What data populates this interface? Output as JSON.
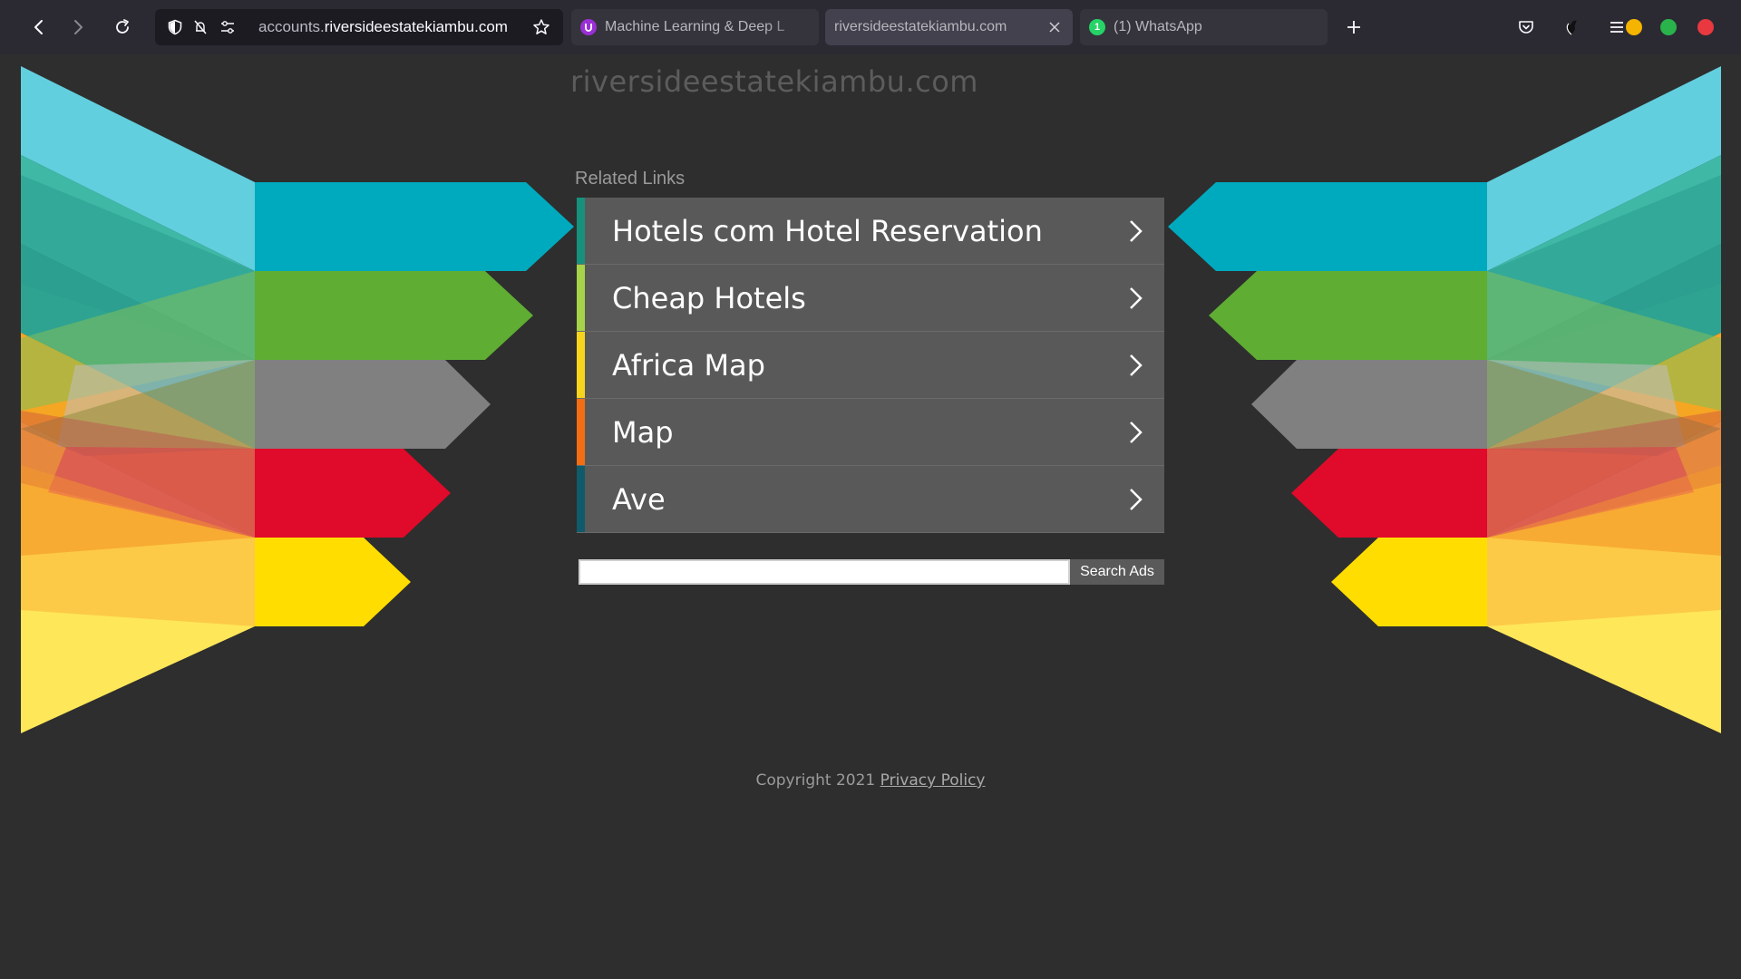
{
  "browser": {
    "url_prefix": "accounts.",
    "url_domain": "riversideestatekiambu.com",
    "tabs": [
      {
        "title": "Machine Learning & Deep L",
        "favicon": "ublock-icon",
        "favicon_color": "#9b2fd6",
        "active": false
      },
      {
        "title": "riversideestatekiambu.com",
        "favicon": "",
        "active": true
      },
      {
        "title": "(1) WhatsApp",
        "favicon": "whatsapp-icon",
        "favicon_color": "#25d366",
        "favicon_badge": "1",
        "active": false
      }
    ],
    "window_controls_colors": {
      "minimize": "#f4b400",
      "maximize": "#2ab24b",
      "close": "#e9383f"
    }
  },
  "page": {
    "site_title": "riversideestatekiambu.com",
    "related_heading": "Related Links",
    "links": [
      {
        "label": "Hotels com Hotel Reservation",
        "accent": "#16917e"
      },
      {
        "label": "Cheap Hotels",
        "accent": "#a6d34a"
      },
      {
        "label": "Africa Map",
        "accent": "#f7d51d"
      },
      {
        "label": "Map",
        "accent": "#f26d14"
      },
      {
        "label": "Ave",
        "accent": "#0f5a6b"
      }
    ],
    "search": {
      "value": "",
      "button_label": "Search Ads"
    },
    "footer": {
      "copyright": "Copyright 2021 ",
      "privacy_label": "Privacy Policy"
    }
  },
  "colors": {
    "arrow_cyan": "#00aabe",
    "arrow_green": "#5fad33",
    "arrow_gray": "#808080",
    "arrow_red": "#e00a2a",
    "arrow_yellow": "#ffdd00",
    "background": "#2e2e2e"
  }
}
